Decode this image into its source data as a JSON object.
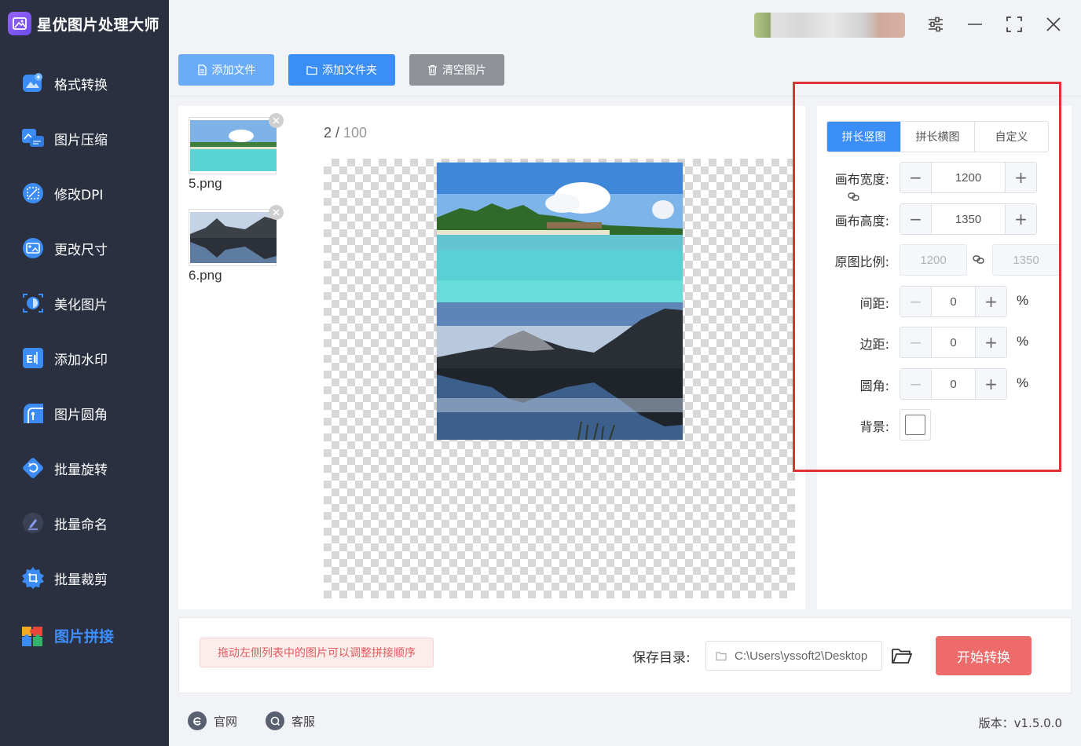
{
  "app": {
    "title": "星优图片处理大师"
  },
  "sidebar": {
    "items": [
      {
        "label": "格式转换",
        "icon": "image-convert-icon"
      },
      {
        "label": "图片压缩",
        "icon": "image-compress-icon"
      },
      {
        "label": "修改DPI",
        "icon": "dpi-icon"
      },
      {
        "label": "更改尺寸",
        "icon": "resize-icon"
      },
      {
        "label": "美化图片",
        "icon": "beautify-icon"
      },
      {
        "label": "添加水印",
        "icon": "watermark-icon"
      },
      {
        "label": "图片圆角",
        "icon": "round-corner-icon"
      },
      {
        "label": "批量旋转",
        "icon": "rotate-icon"
      },
      {
        "label": "批量命名",
        "icon": "rename-icon"
      },
      {
        "label": "批量裁剪",
        "icon": "crop-icon"
      },
      {
        "label": "图片拼接",
        "icon": "puzzle-icon",
        "active": true
      }
    ]
  },
  "toolbar": {
    "add_file": "添加文件",
    "add_folder": "添加文件夹",
    "clear": "清空图片"
  },
  "files": [
    {
      "name": "5.png"
    },
    {
      "name": "6.png"
    }
  ],
  "preview": {
    "current": "2",
    "separator": " / ",
    "total": "100"
  },
  "settings": {
    "tabs": [
      "拼长竖图",
      "拼长横图",
      "自定义"
    ],
    "active_tab": "拼长竖图",
    "canvas_width_label": "画布宽度:",
    "canvas_width": "1200",
    "canvas_height_label": "画布高度:",
    "canvas_height": "1350",
    "ratio_label": "原图比例:",
    "ratio_width": "1200",
    "ratio_height": "1350",
    "spacing_label": "间距:",
    "spacing": "0",
    "margin_label": "边距:",
    "margin": "0",
    "radius_label": "圆角:",
    "radius": "0",
    "percent": "%",
    "background_label": "背景:"
  },
  "bottom": {
    "hint": "拖动左侧列表中的图片可以调整拼接顺序",
    "save_label": "保存目录:",
    "save_path": "C:\\Users\\yssoft2\\Desktop",
    "start": "开始转换"
  },
  "footer": {
    "website": "官网",
    "support": "客服",
    "version": "版本：v1.5.0.0"
  },
  "colors": {
    "accent": "#3a8ef6",
    "sidebar_bg": "#2b3040",
    "start_button": "#ee6b6b",
    "highlight_border": "#e03232"
  }
}
